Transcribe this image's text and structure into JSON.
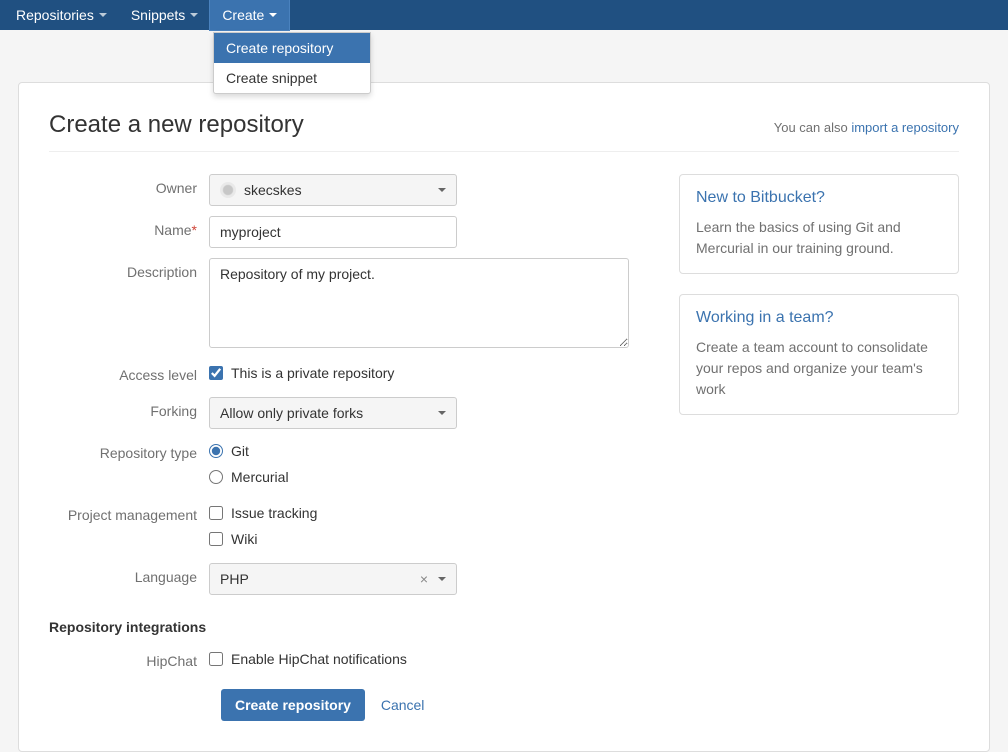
{
  "nav": {
    "repositories": "Repositories",
    "snippets": "Snippets",
    "create": "Create"
  },
  "dropdown": {
    "create_repo": "Create repository",
    "create_snippet": "Create snippet"
  },
  "header": {
    "title": "Create a new repository",
    "import_prefix": "You can also ",
    "import_link": "import a repository"
  },
  "labels": {
    "owner": "Owner",
    "name": "Name",
    "description": "Description",
    "access": "Access level",
    "forking": "Forking",
    "repo_type": "Repository type",
    "pm": "Project management",
    "language": "Language",
    "hipchat": "HipChat"
  },
  "values": {
    "owner": "skecskes",
    "name": "myproject",
    "description": "Repository of my project.",
    "private_label": "This is a private repository",
    "forking": "Allow only private forks",
    "git": "Git",
    "mercurial": "Mercurial",
    "issue_tracking": "Issue tracking",
    "wiki": "Wiki",
    "language": "PHP",
    "hipchat_label": "Enable HipChat notifications"
  },
  "integrations_heading": "Repository integrations",
  "buttons": {
    "submit": "Create repository",
    "cancel": "Cancel"
  },
  "cards": {
    "new_title": "New to Bitbucket?",
    "new_body": "Learn the basics of using Git and Mercurial in our training ground.",
    "team_title": "Working in a team?",
    "team_body": "Create a team account to consolidate your repos and organize your team's work"
  }
}
